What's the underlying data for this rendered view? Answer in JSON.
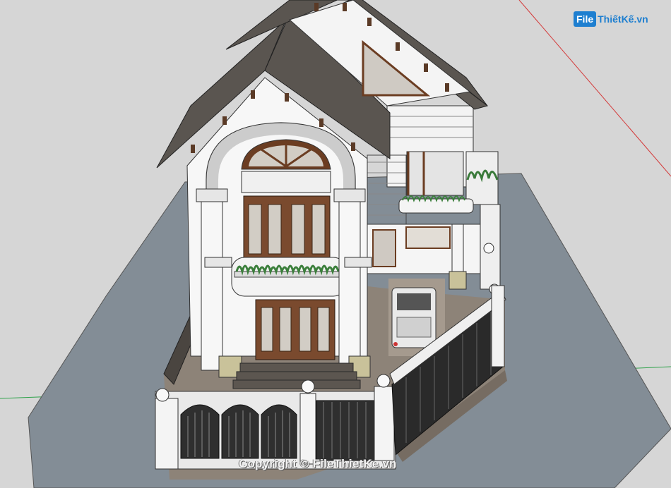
{
  "watermark": {
    "logo_mark": "File",
    "logo_text": "ThiếtKế.vn",
    "copyright": "Copyright © FileThietKe.vn"
  },
  "colors": {
    "background": "#d6d6d6",
    "ground": "#838d96",
    "roof": "#5a5550",
    "wall": "#f7f7f7",
    "door_wood": "#7a4a2e",
    "fence_dark": "#2f2f2f",
    "paving": "#8d8378",
    "axis_red": "#d43a3a",
    "axis_green": "#2fa24a"
  }
}
